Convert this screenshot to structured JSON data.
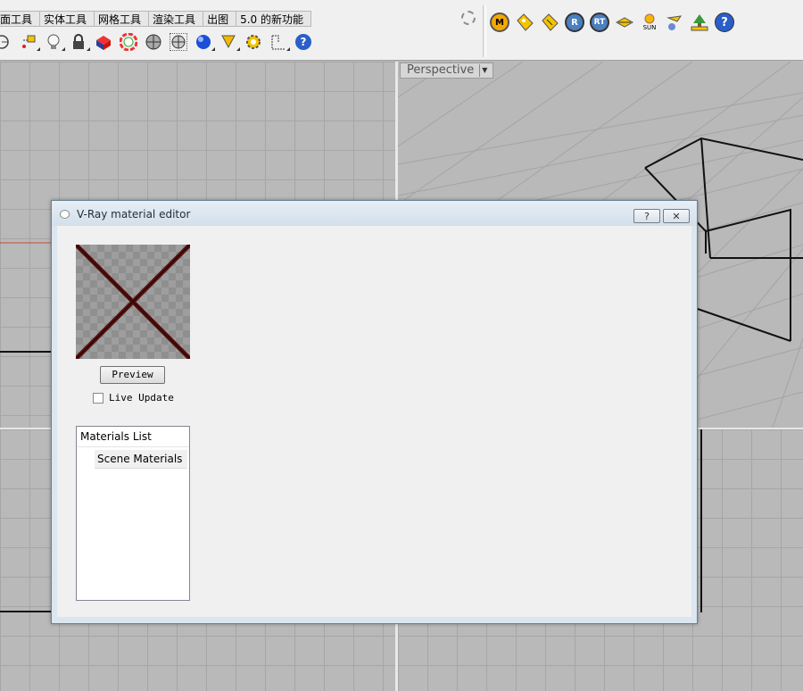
{
  "toolbar": {
    "tabs": [
      "面工具",
      "实体工具",
      "网格工具",
      "渲染工具",
      "出图",
      "5.0 的新功能"
    ],
    "left_icons": [
      "circle-target-icon",
      "point-snap-icon",
      "light-bulb-icon",
      "lock-icon",
      "material-icon",
      "color-wheel-icon",
      "shaded-sphere-icon",
      "rendered-sphere-icon",
      "blue-sphere-icon",
      "cone-icon",
      "settings-gear-icon",
      "dimension-icon",
      "help-icon"
    ],
    "right_icons": [
      "M",
      "material-tag-icon",
      "environment-tag-icon",
      "R",
      "RT",
      "light-lister-icon",
      "SUN",
      "camera-light-icon",
      "tree-icon",
      "?"
    ]
  },
  "viewport": {
    "perspective_label": "Perspective"
  },
  "dialog": {
    "title": "V-Ray material editor",
    "help_label": "?",
    "close_label": "✕",
    "preview_label": "Preview",
    "live_update_label": "Live Update",
    "live_update_checked": false,
    "materials_list_header": "Materials List",
    "materials_items": [
      "Scene Materials"
    ]
  },
  "colors": {
    "viewport_bg": "#b9b9b9",
    "grid": "#a6a6a6",
    "dialog_frame": "#dbe6f0",
    "swatch_cross": "#5a1010"
  }
}
